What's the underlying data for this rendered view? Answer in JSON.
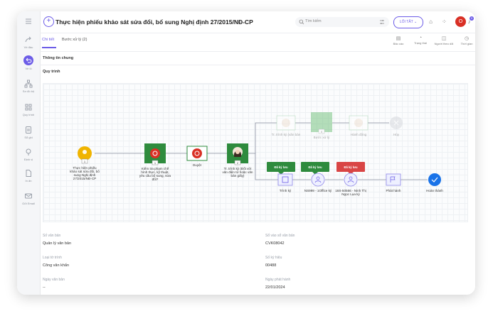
{
  "header": {
    "title": "Thực hiện phiếu khảo sát sửa đổi, bổ sung Nghị định 27/2015/NĐ-CP",
    "search_placeholder": "Tìm kiếm",
    "shortcut_label": "LỐI TẮT",
    "notif_badges": [
      "7",
      "9"
    ],
    "avatar_letter": "O"
  },
  "sidebar": {
    "items": [
      {
        "label": "Về đầu",
        "icon": "share-icon"
      },
      {
        "label": "Về lô",
        "icon": "undo-icon"
      },
      {
        "label": "Sơ đồ bộ",
        "icon": "org-chart-icon"
      },
      {
        "label": "Quy trình",
        "icon": "grid-icon"
      },
      {
        "label": "Sổ ghi",
        "icon": "note-icon"
      },
      {
        "label": "Định vị",
        "icon": "location-icon"
      },
      {
        "label": "In ấn",
        "icon": "document-icon"
      },
      {
        "label": "Gửi Email",
        "icon": "mail-icon"
      }
    ]
  },
  "tabs": [
    {
      "label": "Chi tiết",
      "active": true
    },
    {
      "label": "Bước xử lý (2)",
      "active": false
    }
  ],
  "actions": [
    {
      "label": "Bảo cáo",
      "icon": "report-icon"
    },
    {
      "label": "Trạng thái",
      "icon": "status-icon"
    },
    {
      "label": "Người theo dõi",
      "icon": "follower-icon"
    },
    {
      "label": "Thời gian",
      "icon": "clock-icon"
    }
  ],
  "sections": {
    "general": "Thông tin chung",
    "process": "Quy trình"
  },
  "workflow": {
    "nodes": [
      {
        "key": "start",
        "label": "Thực hiện phiếu khảo sát sửa đổi, bổ sung Nghị định 27/2015/NĐ-CP",
        "lines": [
          "Thực hiện phiếu",
          "khảo sát sửa đổi, bổ",
          "sung Nghị định",
          "27/2015/NĐ-CP"
        ],
        "badge": "1"
      },
      {
        "key": "check",
        "lines": [
          "Kiểm tra phạm chế",
          "hình thực, kỹ thuật,",
          "yêu cầu bổ sung, sửa",
          "đổi?"
        ],
        "badge": "1"
      },
      {
        "key": "approve",
        "lines": [
          "Duyệt"
        ]
      },
      {
        "key": "sign",
        "lines": [
          "Tr. trình ký (Đối với",
          "văn điện tử hoặc văn",
          "bản giấy)"
        ],
        "badge": "2"
      },
      {
        "key": "sign-paper",
        "lines": [
          "Tr. trình ký (văn bản"
        ]
      },
      {
        "key": "process-step",
        "lines": [
          "Bước xử lý"
        ],
        "badge": "0"
      },
      {
        "key": "action",
        "lines": [
          "Hành động"
        ]
      },
      {
        "key": "cancel",
        "lines": [
          "Hủy"
        ]
      },
      {
        "key": "submit",
        "lines": [
          "Trình ký"
        ]
      },
      {
        "key": "office-1",
        "lines": [
          "NS999 - 1Office ký"
        ]
      },
      {
        "key": "office-2",
        "lines": [
          "16S-50566 - Ninh Thị",
          "Ngọc Lụa ký"
        ]
      },
      {
        "key": "publish",
        "lines": [
          "Phát hành"
        ]
      },
      {
        "key": "done",
        "lines": [
          "Hoàn thành"
        ]
      }
    ],
    "flags": [
      {
        "label": "Đã ký lưu",
        "color": "#2e8b3d"
      },
      {
        "label": "Đã ký lưu",
        "color": "#2e8b3d"
      },
      {
        "label": "Đã ký lưu",
        "color": "#d94545"
      }
    ]
  },
  "fields": [
    {
      "label": "Số văn bản",
      "value": "Quản lý văn bản"
    },
    {
      "label": "Sổ vào sổ văn bản",
      "value": "CVK08042"
    },
    {
      "label": "Loại tờ trình",
      "value": "Công văn khẩn"
    },
    {
      "label": "Số ký hiệu",
      "value": "00488"
    },
    {
      "label": "Ngày văn bản",
      "value": "--"
    },
    {
      "label": "Ngày phát hành",
      "value": "22/01/2024"
    }
  ],
  "colors": {
    "accent": "#6c5ce7",
    "green": "#2e8b3d",
    "red": "#d93025",
    "yellow": "#f0b400",
    "blue": "#1a73e8"
  }
}
